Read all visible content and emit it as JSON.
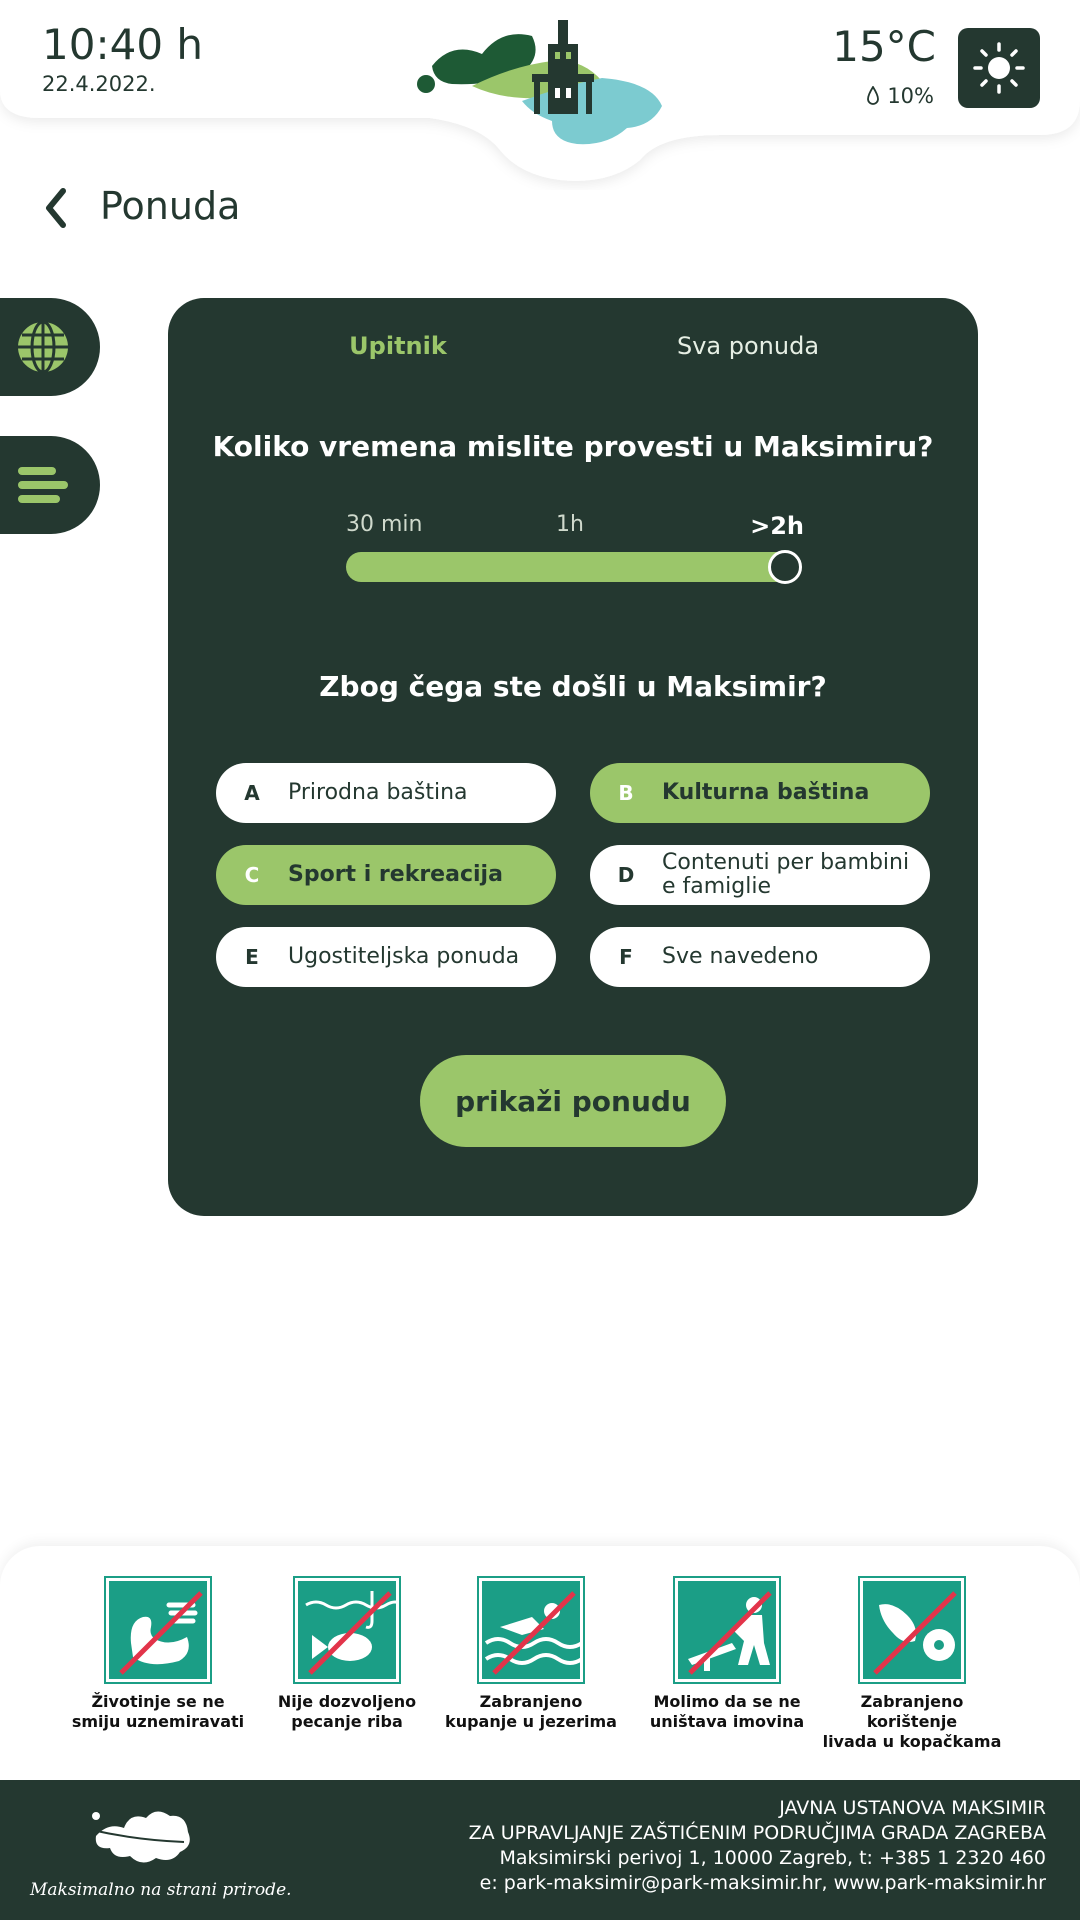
{
  "header": {
    "time": "10:40 h",
    "date": "22.4.2022.",
    "temperature": "15°C",
    "rain": "10%",
    "weather_icon": "sun-icon"
  },
  "page": {
    "title": "Ponuda"
  },
  "tabs": {
    "active": "Upitnik",
    "inactive": "Sva ponuda"
  },
  "question1": {
    "text": "Koliko vremena mislite provesti u Maksimiru?",
    "labels": [
      "30 min",
      "1h",
      ">2h"
    ],
    "selected": ">2h",
    "value_fraction": 1.0
  },
  "question2": {
    "text": "Zbog čega ste došli u Maksimir?",
    "options": [
      {
        "letter": "A",
        "label": "Prirodna baština",
        "selected": false
      },
      {
        "letter": "B",
        "label": "Kulturna baština",
        "selected": true
      },
      {
        "letter": "C",
        "label": "Sport i rekreacija",
        "selected": true
      },
      {
        "letter": "D",
        "label": "Contenuti per bambini e famiglie",
        "selected": false
      },
      {
        "letter": "E",
        "label": "Ugostiteljska ponuda",
        "selected": false
      },
      {
        "letter": "F",
        "label": "Sve navedeno",
        "selected": false
      }
    ]
  },
  "cta": {
    "label": "prikaži ponudu"
  },
  "rules": [
    {
      "line1": "Životinje se ne",
      "line2": "smiju uznemiravati",
      "icon": "no-disturbing-animals-icon"
    },
    {
      "line1": "Nije dozvoljeno",
      "line2": "pecanje riba",
      "icon": "no-fishing-icon"
    },
    {
      "line1": "Zabranjeno",
      "line2": "kupanje u jezerima",
      "icon": "no-swimming-icon"
    },
    {
      "line1": "Molimo da se ne",
      "line2": "uništava imovina",
      "icon": "no-vandalism-icon"
    },
    {
      "line1": "Zabranjeno korištenje",
      "line2": "livada u kopačkama",
      "icon": "no-football-boots-icon"
    }
  ],
  "footer": {
    "slogan": "Maksimalno na strani prirode.",
    "line1": "JAVNA USTANOVA MAKSIMIR",
    "line2": "ZA UPRAVLJANJE ZAŠTIĆENIM PODRUČJIMA GRADA ZAGREBA",
    "line3": "Maksimirski perivoj 1, 10000 Zagreb, t: +385 1 2320 460",
    "line4": "e: park-maksimir@park-maksimir.hr, www.park-maksimir.hr"
  },
  "colors": {
    "dark_green": "#243830",
    "accent_green": "#9bc66a",
    "sign_teal": "#1b9e86",
    "prohibition_red": "#e2344a"
  }
}
